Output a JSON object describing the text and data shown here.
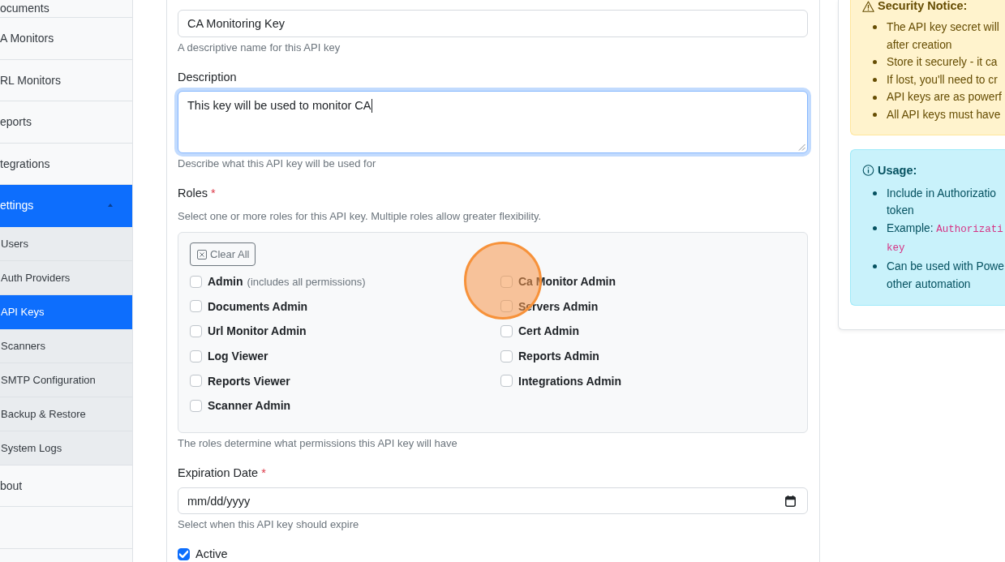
{
  "sidebar": {
    "items": [
      {
        "label": "ocuments",
        "selected": false
      },
      {
        "label": "A Monitors",
        "selected": false
      },
      {
        "label": "RL Monitors",
        "selected": false
      },
      {
        "label": "eports",
        "selected": false
      },
      {
        "label": "tegrations",
        "selected": false
      },
      {
        "label": "ettings",
        "selected": true,
        "expanded": true,
        "children": [
          {
            "label": "Users",
            "selected": false
          },
          {
            "label": "Auth Providers",
            "selected": false
          },
          {
            "label": "API Keys",
            "selected": true
          },
          {
            "label": "Scanners",
            "selected": false
          },
          {
            "label": "SMTP Configuration",
            "selected": false
          },
          {
            "label": "Backup & Restore",
            "selected": false
          },
          {
            "label": "System Logs",
            "selected": false
          }
        ]
      },
      {
        "label": "bout",
        "selected": false
      }
    ]
  },
  "form": {
    "name_field": {
      "value": "CA Monitoring Key",
      "help": "A descriptive name for this API key"
    },
    "description_field": {
      "label": "Description",
      "value": "This key will be used to monitor CA",
      "focused": true,
      "help": "Describe what this API key will be used for"
    },
    "roles": {
      "label": "Roles",
      "required_mark": "*",
      "hint": "Select one or more roles for this API key. Multiple roles allow greater flexibility.",
      "clear_button": "Clear All",
      "items": [
        {
          "label": "Admin",
          "note": "(includes all permissions)",
          "checked": false
        },
        {
          "label": "Ca Monitor Admin",
          "checked": false
        },
        {
          "label": "Documents Admin",
          "checked": false
        },
        {
          "label": "Servers Admin",
          "checked": false
        },
        {
          "label": "Url Monitor Admin",
          "checked": false
        },
        {
          "label": "Cert Admin",
          "checked": false
        },
        {
          "label": "Log Viewer",
          "checked": false
        },
        {
          "label": "Reports Admin",
          "checked": false
        },
        {
          "label": "Reports Viewer",
          "checked": false
        },
        {
          "label": "Integrations Admin",
          "checked": false
        },
        {
          "label": "Scanner Admin",
          "checked": false
        }
      ],
      "help": "The roles determine what permissions this API key will have"
    },
    "expiration_field": {
      "label": "Expiration Date",
      "required_mark": "*",
      "placeholder": "mm/dd/yyyy",
      "help": "Select when this API key should expire"
    },
    "active": {
      "label": "Active",
      "checked": true
    }
  },
  "security_notice": {
    "title": "Security Notice:",
    "items": [
      {
        "kind": "text",
        "lines": [
          "The API key secret will",
          "after creation"
        ]
      },
      {
        "kind": "text",
        "lines": [
          "Store it securely - it ca"
        ]
      },
      {
        "kind": "text",
        "lines": [
          "If lost, you'll need to cr"
        ]
      },
      {
        "kind": "text",
        "lines": [
          "API keys are as powerf"
        ]
      },
      {
        "kind": "text",
        "lines": [
          "All API keys must have"
        ]
      }
    ]
  },
  "usage": {
    "title": "Usage:",
    "items": [
      {
        "kind": "text",
        "lines": [
          "Include in Authorizatio",
          "token"
        ]
      },
      {
        "kind": "code",
        "text": "Example:",
        "code_lines": [
          "Authorizati",
          "key"
        ]
      },
      {
        "kind": "text",
        "lines": [
          "Can be used with Powe",
          "other automation"
        ]
      }
    ]
  }
}
